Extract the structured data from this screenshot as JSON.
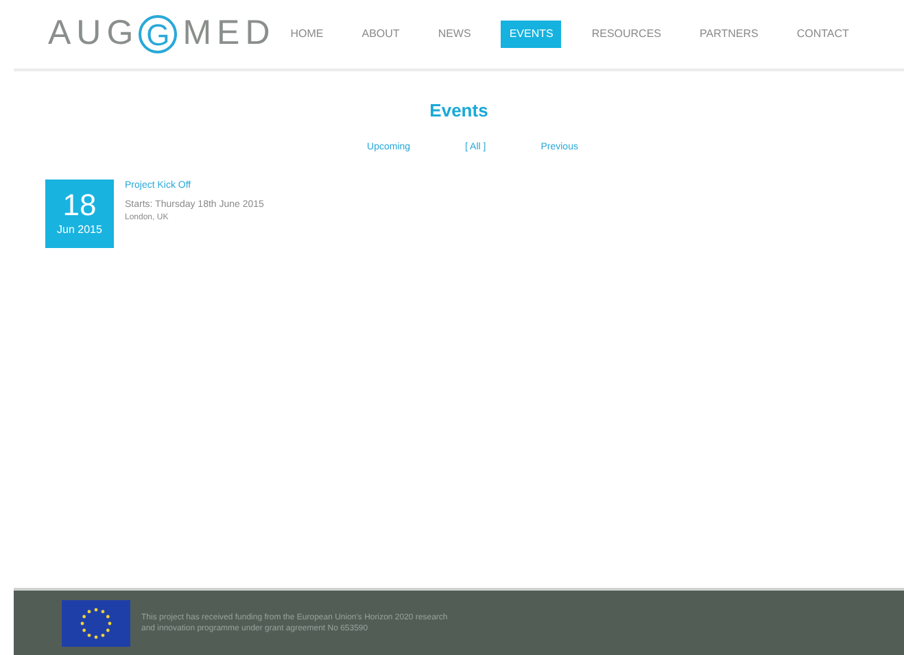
{
  "logo": {
    "before": "AUG",
    "mark": "G",
    "after": "MED"
  },
  "nav": [
    {
      "label": "HOME",
      "selected": false
    },
    {
      "label": "ABOUT",
      "selected": false
    },
    {
      "label": "NEWS",
      "selected": false
    },
    {
      "label": "EVENTS",
      "selected": true
    },
    {
      "label": "RESOURCES",
      "selected": false
    },
    {
      "label": "PARTNERS",
      "selected": false
    },
    {
      "label": "CONTACT",
      "selected": false
    }
  ],
  "title": "Events",
  "filters": [
    "Upcoming",
    "[ All ]",
    "Previous"
  ],
  "events": [
    {
      "day": "18",
      "month": "Jun 2015",
      "title": "Project Kick Off",
      "starts": "Starts: Thursday 18th June 2015",
      "location": "London, UK"
    }
  ],
  "footer": {
    "text": "This project has received funding from the European Union's Horizon 2020 research and innovation programme under grant agreement No 653590"
  }
}
